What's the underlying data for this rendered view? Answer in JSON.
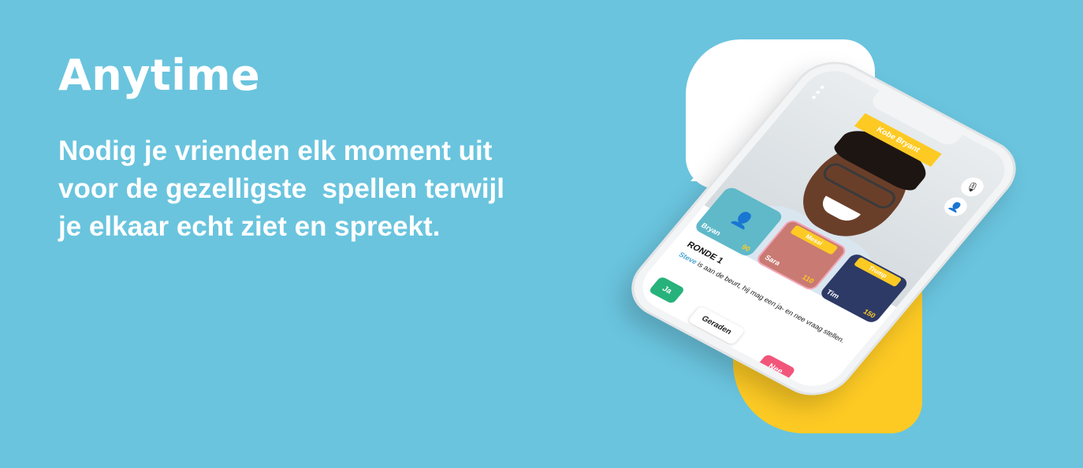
{
  "hero": {
    "title": "Anytime",
    "lines": [
      "Nodig je vrienden elk moment uit",
      "voor de gezelligste  spellen terwijl",
      "je elkaar echt ziet en spreekt."
    ]
  },
  "phone": {
    "top_player": "Steve",
    "word": "Kobe Bryant",
    "tiles": [
      {
        "name": "Bryan",
        "score": "90",
        "word": ""
      },
      {
        "name": "Sara",
        "score": "110",
        "word": "Messi"
      },
      {
        "name": "Tim",
        "score": "150",
        "word": "Trump"
      }
    ],
    "round": {
      "title": "RONDE 1",
      "player": "Steve",
      "text": " is aan de beurt, hij mag een ja- en nee vraag stellen."
    },
    "buttons": {
      "yes": "Ja",
      "guessed": "Geraden",
      "no": "Nee"
    }
  },
  "colors": {
    "background": "#6ac4de",
    "yellow": "#fdca24",
    "green": "#27b27b",
    "pink": "#f2557a"
  }
}
